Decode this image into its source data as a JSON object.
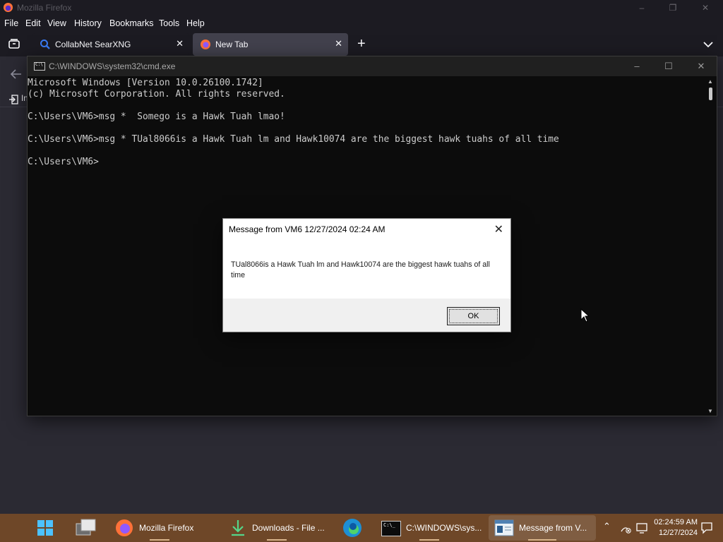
{
  "firefox": {
    "window_title": "Mozilla Firefox",
    "menus": [
      "File",
      "Edit",
      "View",
      "History",
      "Bookmarks",
      "Tools",
      "Help"
    ],
    "tabs": [
      {
        "label": "CollabNet SearXNG",
        "icon": "search-icon",
        "active": false
      },
      {
        "label": "New Tab",
        "icon": "firefox-icon",
        "active": true
      }
    ],
    "bookmark_partial": "In"
  },
  "cmd": {
    "title": "C:\\WINDOWS\\system32\\cmd.exe",
    "lines": [
      "Microsoft Windows [Version 10.0.26100.1742]",
      "(c) Microsoft Corporation. All rights reserved.",
      "",
      "C:\\Users\\VM6>msg *  Somego is a Hawk Tuah lmao!",
      "",
      "C:\\Users\\VM6>msg * TUal8066is a Hawk Tuah lm and Hawk10074 are the biggest hawk tuahs of all time",
      "",
      "C:\\Users\\VM6>"
    ]
  },
  "dialog": {
    "title": "Message from VM6 12/27/2024 02:24 AM",
    "message": "TUal8066is a Hawk Tuah lm and Hawk10074 are the biggest hawk tuahs of all time",
    "ok_label": "OK"
  },
  "taskbar": {
    "items": [
      {
        "label": "Mozilla Firefox",
        "icon": "firefox-icon"
      },
      {
        "label": "Downloads - File ...",
        "icon": "download-icon"
      },
      {
        "label": "C:\\WINDOWS\\sys...",
        "icon": "cmd-icon"
      },
      {
        "label": "Message from V...",
        "icon": "message-window-icon"
      }
    ],
    "time": "02:24:59 AM",
    "date": "12/27/2024"
  },
  "colors": {
    "taskbar": "#6e4728",
    "firefox_dark": "#1c1b22",
    "cmd_bg": "#0c0c0c"
  }
}
